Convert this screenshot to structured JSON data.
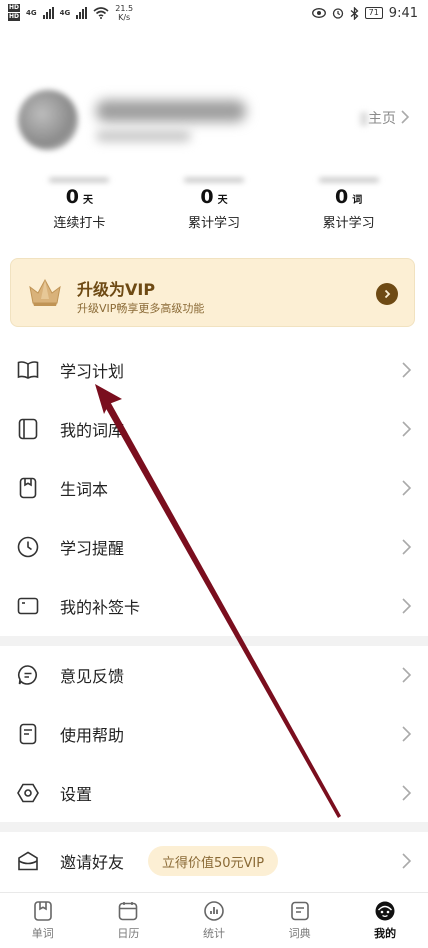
{
  "status_bar": {
    "hd_badges": [
      "HD",
      "HD"
    ],
    "network": "4G",
    "speed_value": "21.5",
    "speed_unit": "K/s",
    "battery": "71",
    "time": "9:41"
  },
  "profile": {
    "homepage_label": "主页"
  },
  "stats": [
    {
      "value": "0",
      "unit": "天",
      "label": "连续打卡"
    },
    {
      "value": "0",
      "unit": "天",
      "label": "累计学习"
    },
    {
      "value": "0",
      "unit": "词",
      "label": "累计学习"
    }
  ],
  "vip": {
    "title": "升级为VIP",
    "subtitle": "升级VIP畅享更多高级功能"
  },
  "menu": {
    "study_plan": "学习计划",
    "my_wordbook": "我的词库",
    "new_words": "生词本",
    "reminder": "学习提醒",
    "makeup_card": "我的补签卡",
    "feedback": "意见反馈",
    "help": "使用帮助",
    "settings": "设置",
    "invite": "邀请好友",
    "invite_badge": "立得价值50元VIP"
  },
  "bottom_nav": [
    {
      "label": "单词",
      "icon": "word-card-icon"
    },
    {
      "label": "日历",
      "icon": "calendar-icon"
    },
    {
      "label": "统计",
      "icon": "stats-icon"
    },
    {
      "label": "词典",
      "icon": "dictionary-icon"
    },
    {
      "label": "我的",
      "icon": "profile-face-icon",
      "active": true
    }
  ],
  "colors": {
    "vip_bg": "#fcefd4",
    "vip_text": "#6e4a14",
    "annotation_arrow": "#7a0e1e"
  }
}
